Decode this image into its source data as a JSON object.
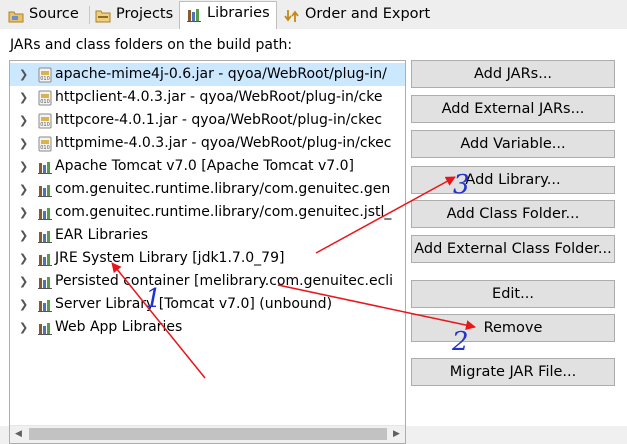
{
  "tabs": [
    {
      "label": "Source",
      "icon": "source-folder-icon",
      "active": false
    },
    {
      "label": "Projects",
      "icon": "projects-icon",
      "active": false
    },
    {
      "label": "Libraries",
      "icon": "libraries-icon",
      "active": true
    },
    {
      "label": "Order and Export",
      "icon": "order-export-icon",
      "active": false
    }
  ],
  "panel": {
    "caption": "JARs and class folders on the build path:"
  },
  "tree": {
    "items": [
      {
        "label": "apache-mime4j-0.6.jar - qyoa/WebRoot/plug-in/",
        "icon": "jar-icon",
        "selected": true
      },
      {
        "label": "httpclient-4.0.3.jar - qyoa/WebRoot/plug-in/cke",
        "icon": "jar-icon"
      },
      {
        "label": "httpcore-4.0.1.jar - qyoa/WebRoot/plug-in/ckec",
        "icon": "jar-icon"
      },
      {
        "label": "httpmime-4.0.3.jar - qyoa/WebRoot/plug-in/ckec",
        "icon": "jar-icon"
      },
      {
        "label": "Apache Tomcat v7.0 [Apache Tomcat v7.0]",
        "icon": "library-icon"
      },
      {
        "label": "com.genuitec.runtime.library/com.genuitec.gen",
        "icon": "library-icon"
      },
      {
        "label": "com.genuitec.runtime.library/com.genuitec.jstl_",
        "icon": "library-icon"
      },
      {
        "label": "EAR Libraries",
        "icon": "library-icon"
      },
      {
        "label": "JRE System Library [jdk1.7.0_79]",
        "icon": "library-icon"
      },
      {
        "label": "Persisted container [melibrary.com.genuitec.ecli",
        "icon": "library-icon"
      },
      {
        "label": "Server Library [Tomcat v7.0] (unbound)",
        "icon": "library-icon"
      },
      {
        "label": "Web App Libraries",
        "icon": "library-icon"
      }
    ]
  },
  "buttons": {
    "add_jars": "Add JARs...",
    "add_external_jars": "Add External JARs...",
    "add_variable": "Add Variable...",
    "add_library": "Add Library...",
    "add_class_folder": "Add Class Folder...",
    "add_external_class_folder": "Add External Class Folder...",
    "edit": "Edit...",
    "remove": "Remove",
    "migrate_jar": "Migrate JAR File..."
  },
  "annotations": {
    "n1": "1",
    "n2": "2",
    "n3": "3",
    "arrow_color": "#e8161b"
  },
  "colors": {
    "selection": "#cce8ff",
    "button_bg": "#e1e1e1"
  }
}
